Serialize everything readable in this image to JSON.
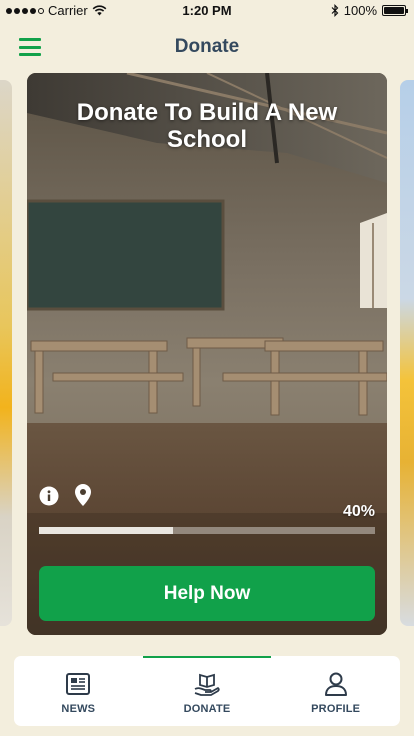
{
  "status_bar": {
    "carrier": "Carrier",
    "time": "1:20 PM",
    "battery": "100%"
  },
  "header": {
    "title": "Donate",
    "menu_icon": "hamburger-menu-icon"
  },
  "card": {
    "title": "Donate To Build A New School",
    "progress_percent": "40%",
    "progress_value": 0.4,
    "button_label": "Help Now",
    "icons": [
      "info-icon",
      "location-pin-icon"
    ]
  },
  "nav": {
    "items": [
      {
        "label": "NEWS",
        "icon": "newspaper-icon",
        "active": false
      },
      {
        "label": "DONATE",
        "icon": "donate-hand-book-icon",
        "active": true
      },
      {
        "label": "PROFILE",
        "icon": "user-icon",
        "active": false
      }
    ]
  },
  "colors": {
    "accent": "#11a14a",
    "background": "#f3eedd",
    "title_text": "#34495e"
  }
}
